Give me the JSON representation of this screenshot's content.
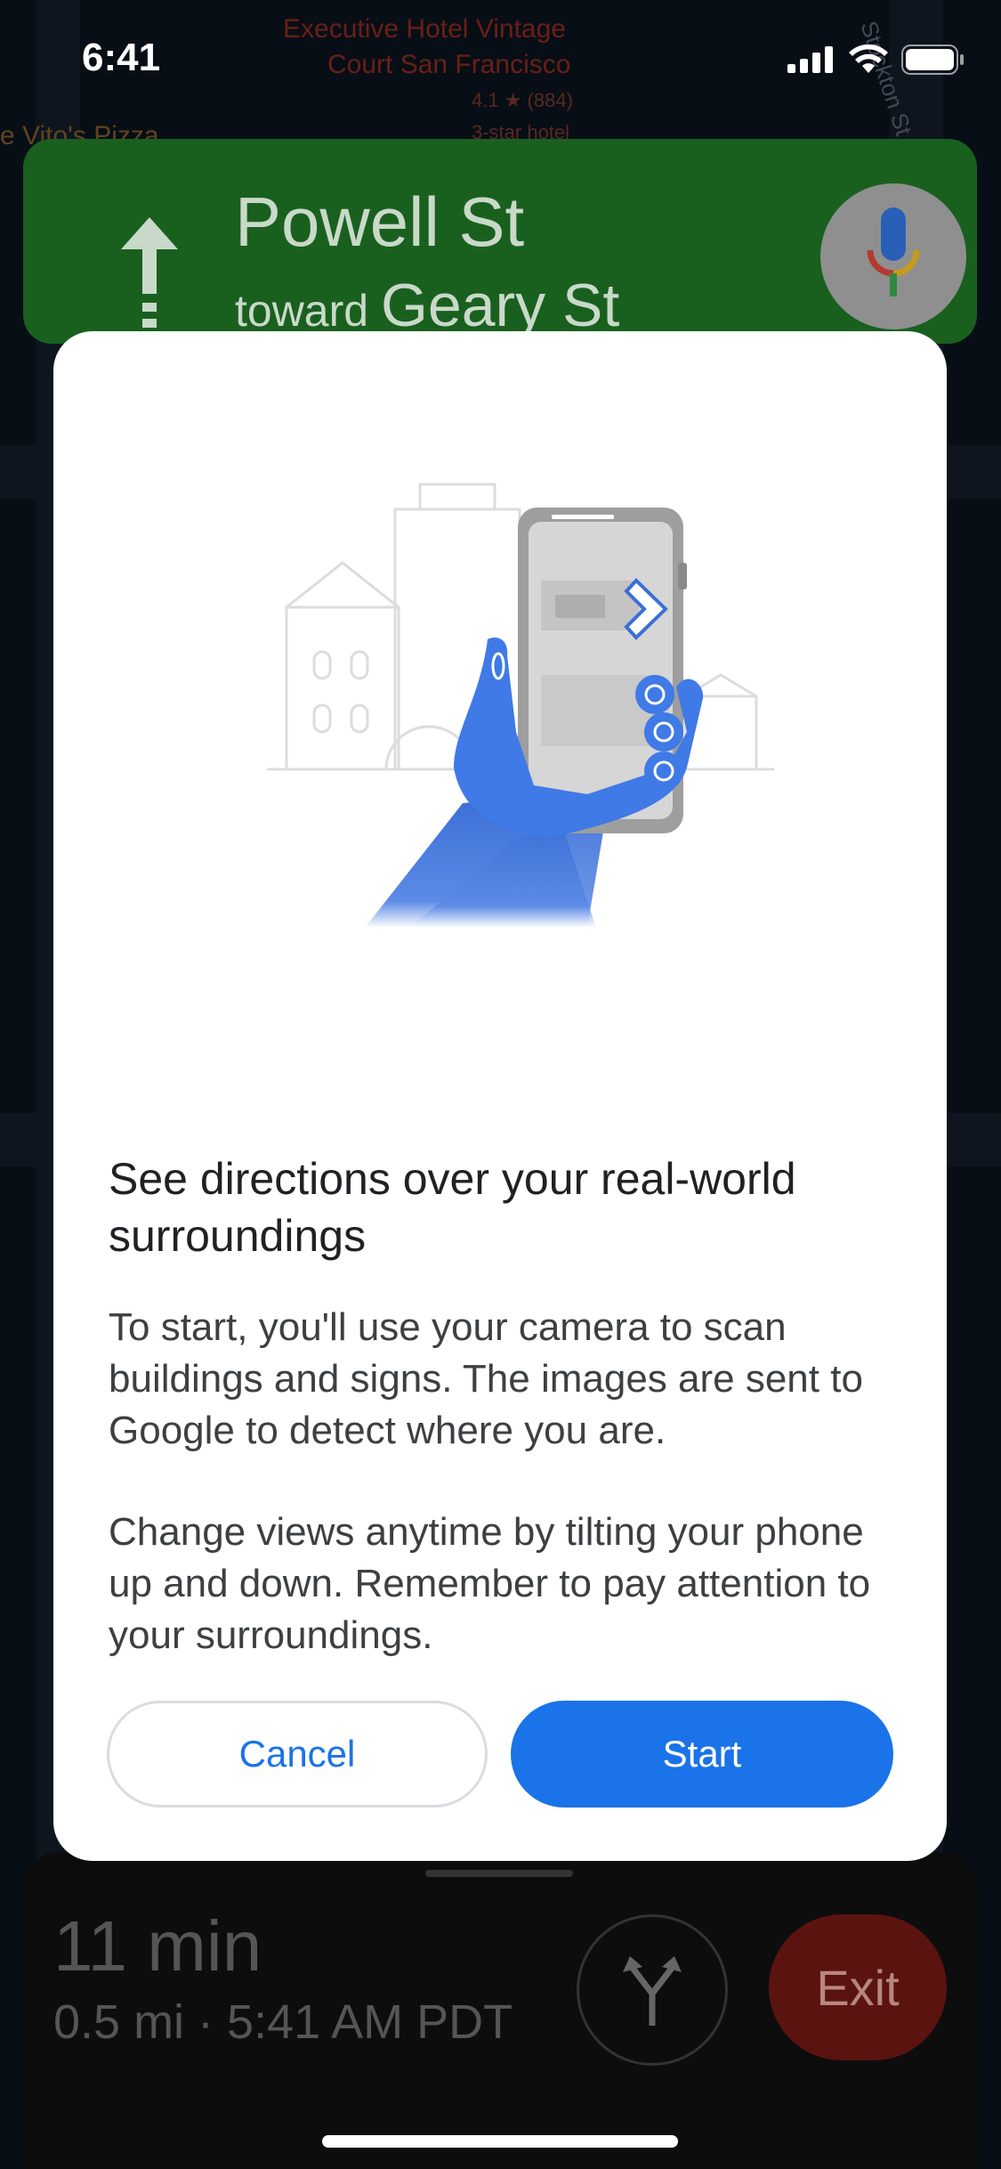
{
  "status_bar": {
    "time": "6:41"
  },
  "map": {
    "labels": [
      {
        "text": "Executive Hotel Vintage",
        "color": "#c0392b"
      },
      {
        "text": "Court San Francisco",
        "color": "#c0392b"
      },
      {
        "text": "4.1 ★ (884)",
        "color": "#a04a3d"
      },
      {
        "text": "3-star hotel",
        "color": "#a04a3d"
      },
      {
        "text": "e Vito's Pizza",
        "color": "#b07a3a"
      },
      {
        "text": "Stockton St",
        "color": "#7a8597"
      }
    ]
  },
  "nav_banner": {
    "street": "Powell St",
    "toward_prefix": "toward",
    "toward_street": "Geary St",
    "color": "#19601f"
  },
  "dialog": {
    "title": "See directions over your real-world surroundings",
    "paragraph1": "To start, you'll use your camera to scan buildings and signs. The images are sent to Google to detect where you are.",
    "paragraph2": "Change views anytime by tilting your phone up and down. Remember to pay attention to your surroundings.",
    "cancel_label": "Cancel",
    "start_label": "Start",
    "accent": "#1a73e8"
  },
  "trip": {
    "eta": "11 min",
    "details": "0.5 mi · 5:41 AM PDT",
    "exit_label": "Exit"
  }
}
